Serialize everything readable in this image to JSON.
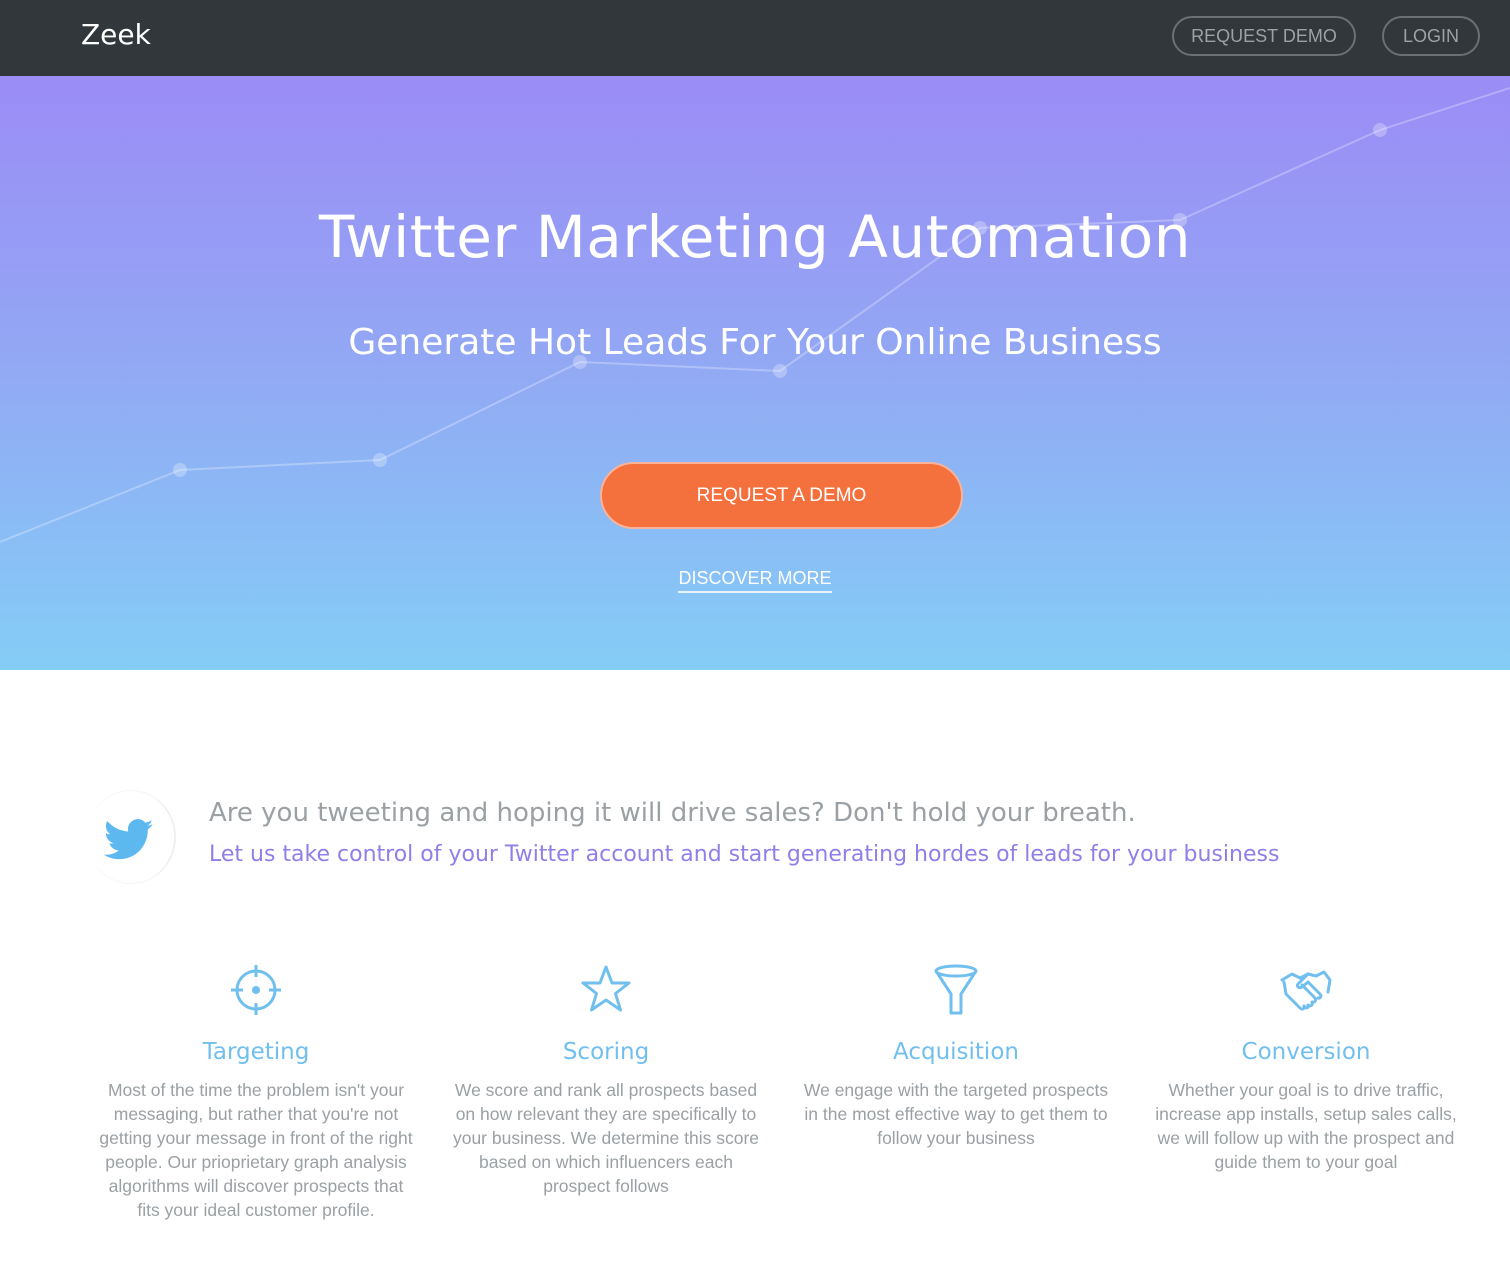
{
  "navbar": {
    "brand": "Zeek",
    "request_demo_label": "REQUEST DEMO",
    "login_label": "LOGIN"
  },
  "hero": {
    "title": "Twitter Marketing Automation",
    "subtitle": "Generate Hot Leads For Your Online Business",
    "cta_label": "REQUEST A DEMO",
    "discover_label": "DISCOVER MORE"
  },
  "intro": {
    "icon": "twitter-bird-icon",
    "question": "Are you tweeting and hoping it will drive sales? Don't hold your breath.",
    "pitch": "Let us take control of your Twitter account and start generating hordes of leads for your business"
  },
  "features": [
    {
      "icon": "crosshair-icon",
      "title": "Targeting",
      "text": "Most of the time the problem isn't your messaging, but rather that you're not getting your message in front of the right people. Our prioprietary graph analysis algorithms will discover prospects that fits your ideal customer profile."
    },
    {
      "icon": "star-icon",
      "title": "Scoring",
      "text": "We score and rank all prospects based on how relevant they are specifically to your business. We determine this score based on which influencers each prospect follows"
    },
    {
      "icon": "funnel-icon",
      "title": "Acquisition",
      "text": "We engage with the targeted prospects in the most effective way to get them to follow your business"
    },
    {
      "icon": "handshake-icon",
      "title": "Conversion",
      "text": "Whether your goal is to drive traffic, increase app installs, setup sales calls, we will follow up with the prospect and guide them to your goal"
    }
  ],
  "colors": {
    "navbar_bg": "#31373a",
    "hero_gradient_top": "#9b8cf6",
    "hero_gradient_bottom": "#84cdf6",
    "cta_bg": "#f4703d",
    "feature_title": "#71bfee",
    "pitch_text": "#8f7fe8",
    "body_text": "#9aa0a4"
  }
}
